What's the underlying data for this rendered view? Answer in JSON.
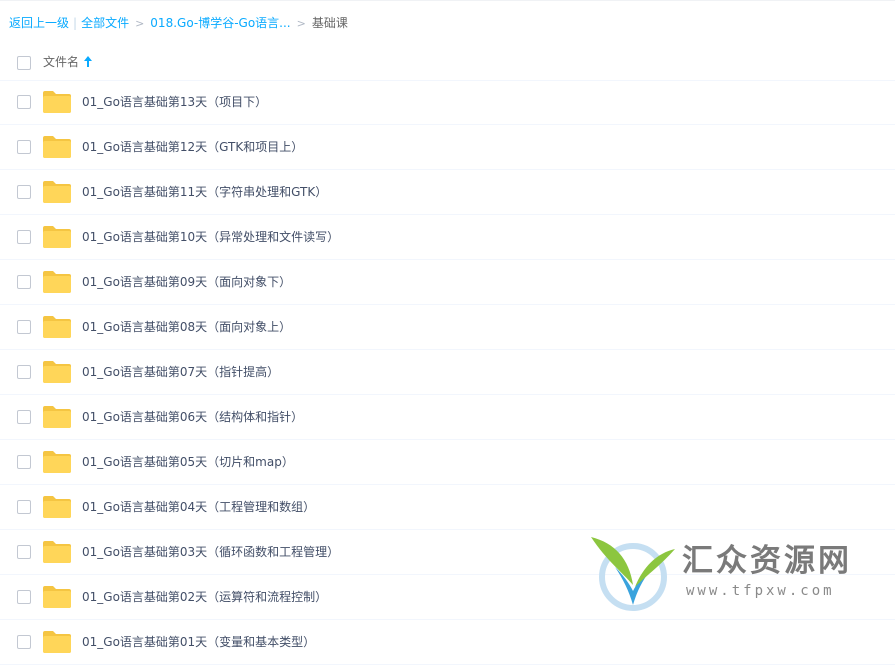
{
  "breadcrumb": {
    "back": "返回上一级",
    "all_files": "全部文件",
    "parent": "018.Go-博学谷-Go语言...",
    "current": "基础课",
    "bar_separator": "|",
    "gt_separator": ">"
  },
  "list_header": {
    "name_column": "文件名",
    "sort": "ascending"
  },
  "files": [
    {
      "name": "01_Go语言基础第13天（项目下）"
    },
    {
      "name": "01_Go语言基础第12天（GTK和项目上）"
    },
    {
      "name": "01_Go语言基础第11天（字符串处理和GTK）"
    },
    {
      "name": "01_Go语言基础第10天（异常处理和文件读写）"
    },
    {
      "name": "01_Go语言基础第09天（面向对象下）"
    },
    {
      "name": "01_Go语言基础第08天（面向对象上）"
    },
    {
      "name": "01_Go语言基础第07天（指针提高）"
    },
    {
      "name": "01_Go语言基础第06天（结构体和指针）"
    },
    {
      "name": "01_Go语言基础第05天（切片和map）"
    },
    {
      "name": "01_Go语言基础第04天（工程管理和数组）"
    },
    {
      "name": "01_Go语言基础第03天（循环函数和工程管理）"
    },
    {
      "name": "01_Go语言基础第02天（运算符和流程控制）"
    },
    {
      "name": "01_Go语言基础第01天（变量和基本类型）"
    }
  ],
  "watermark": {
    "title": "汇众资源网",
    "url": "www.tfpxw.com"
  },
  "colors": {
    "link": "#09aaff",
    "folder": "#ffd659",
    "text": "#424e67",
    "divider": "#f2f6fd"
  },
  "icons": {
    "folder": "folder-icon",
    "sort": "arrow-up-icon",
    "checkbox": "checkbox-icon"
  }
}
